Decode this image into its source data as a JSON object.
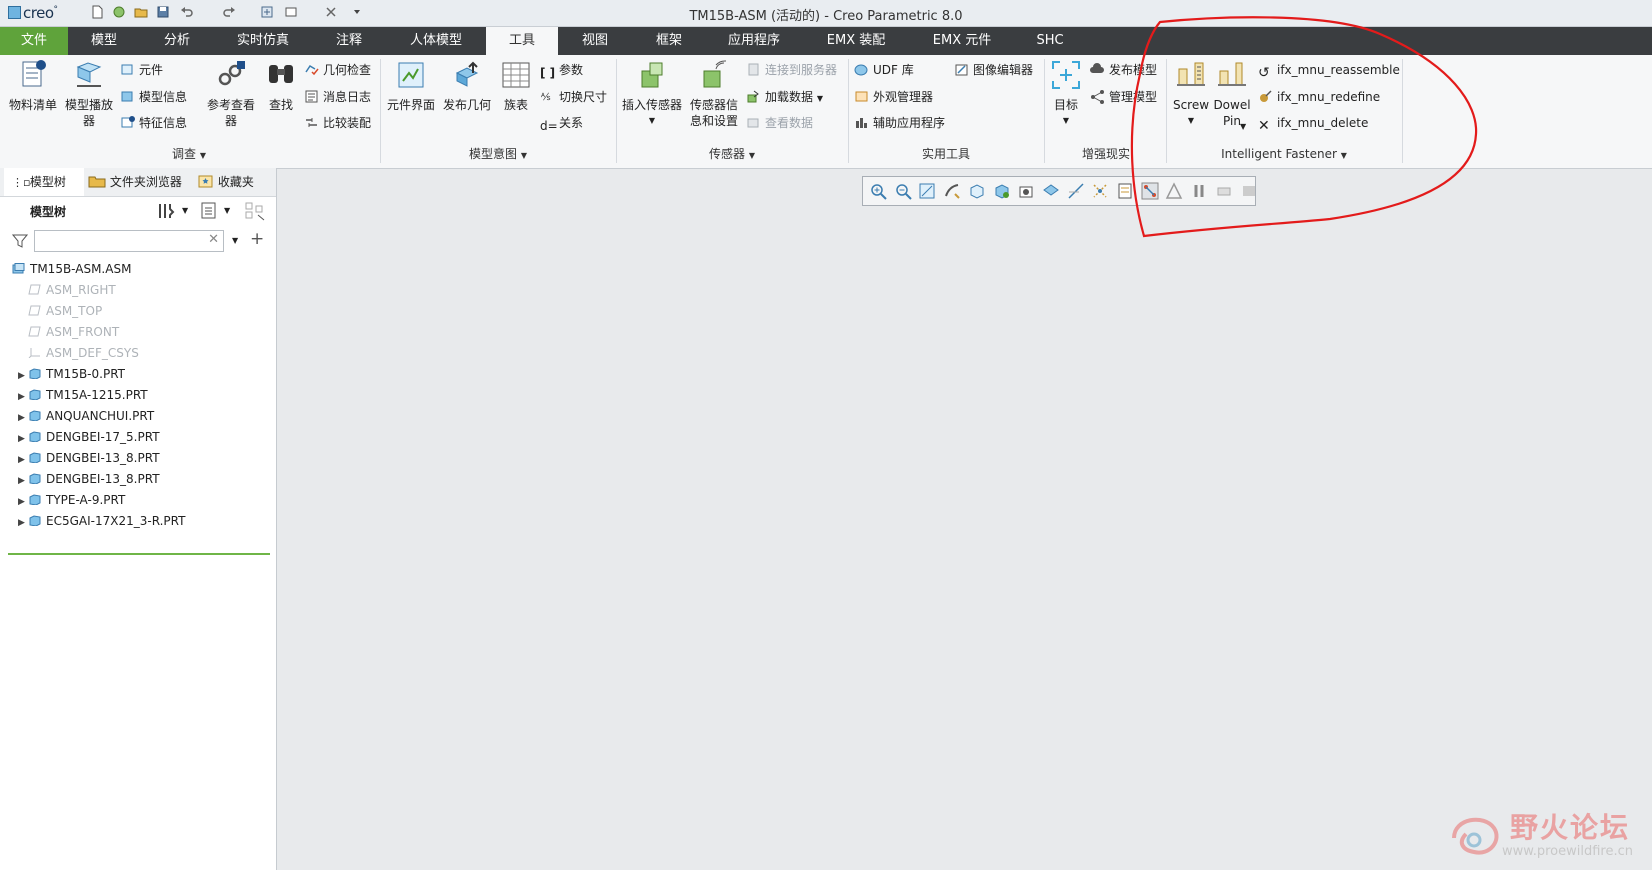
{
  "app": {
    "logo_text": "creo",
    "window_title": "TM15B-ASM (活动的) - Creo Parametric 8.0",
    "quick_access_icons": [
      "new-icon",
      "open-session-icon",
      "open-icon",
      "save-icon",
      "undo-icon",
      "redo-icon",
      "regenerate-icon",
      "window-icon",
      "close-window-icon",
      "customize-icon"
    ]
  },
  "ribbon_tabs": [
    "文件",
    "模型",
    "分析",
    "实时仿真",
    "注释",
    "人体模型",
    "工具",
    "视图",
    "框架",
    "应用程序",
    "EMX 装配",
    "EMX 元件",
    "SHC"
  ],
  "active_tab": "工具",
  "ribbon": {
    "investigate": {
      "label": "调查",
      "bom": "物料清单",
      "model_player": "模型播放器",
      "component": "元件",
      "model_info": "模型信息",
      "feature_info": "特征信息",
      "ref_viewer": "参考查看器",
      "find": "查找",
      "geom_check": "几何检查",
      "message_log": "消息日志",
      "compare_parts": "比较装配"
    },
    "model_intent": {
      "label": "模型意图",
      "comp_interface": "元件界面",
      "publish_geom": "发布几何",
      "family_table": "族表",
      "params": "参数",
      "switch_dims": "切换尺寸",
      "relations": "关系"
    },
    "sensors": {
      "label": "传感器",
      "insert_sensor": "插入传感器",
      "sensor_info": "传感器信息和设置",
      "connect_server": "连接到服务器",
      "load_data": "加载数据",
      "view_data": "查看数据"
    },
    "utilities": {
      "label": "实用工具",
      "udf_lib": "UDF 库",
      "image_editor": "图像编辑器",
      "appearance_mgr": "外观管理器",
      "aux_apps": "辅助应用程序"
    },
    "ar": {
      "label": "增强现实",
      "target": "目标",
      "publish_model": "发布模型",
      "manage_model": "管理模型"
    },
    "fastener": {
      "label": "Intelligent Fastener",
      "screw": "Screw",
      "dowel_pin": "Dowel Pin",
      "reassemble": "ifx_mnu_reassemble",
      "redefine": "ifx_mnu_redefine",
      "delete": "ifx_mnu_delete"
    }
  },
  "left_panel": {
    "tabs": [
      "模型树",
      "文件夹浏览器",
      "收藏夹"
    ],
    "header": "模型树",
    "filter_placeholder": "",
    "tree": [
      {
        "label": "TM15B-ASM.ASM",
        "type": "asm",
        "expandable": false,
        "dim": false,
        "indent": 0
      },
      {
        "label": "ASM_RIGHT",
        "type": "plane",
        "expandable": false,
        "dim": true,
        "indent": 1
      },
      {
        "label": "ASM_TOP",
        "type": "plane",
        "expandable": false,
        "dim": true,
        "indent": 1
      },
      {
        "label": "ASM_FRONT",
        "type": "plane",
        "expandable": false,
        "dim": true,
        "indent": 1
      },
      {
        "label": "ASM_DEF_CSYS",
        "type": "csys",
        "expandable": false,
        "dim": true,
        "indent": 1
      },
      {
        "label": "TM15B-0.PRT",
        "type": "part",
        "expandable": true,
        "dim": false,
        "indent": 1
      },
      {
        "label": "TM15A-1215.PRT",
        "type": "part",
        "expandable": true,
        "dim": false,
        "indent": 1
      },
      {
        "label": "ANQUANCHUI.PRT",
        "type": "part",
        "expandable": true,
        "dim": false,
        "indent": 1
      },
      {
        "label": "DENGBEI-17_5.PRT",
        "type": "part",
        "expandable": true,
        "dim": false,
        "indent": 1
      },
      {
        "label": "DENGBEI-13_8.PRT",
        "type": "part",
        "expandable": true,
        "dim": false,
        "indent": 1
      },
      {
        "label": "DENGBEI-13_8.PRT",
        "type": "part",
        "expandable": true,
        "dim": false,
        "indent": 1
      },
      {
        "label": "TYPE-A-9.PRT",
        "type": "part",
        "expandable": true,
        "dim": false,
        "indent": 1
      },
      {
        "label": "EC5GAI-17X21_3-R.PRT",
        "type": "part",
        "expandable": true,
        "dim": false,
        "indent": 1
      }
    ]
  },
  "view_toolbar": [
    "zoom-in-icon",
    "zoom-out-icon",
    "refit-icon",
    "reorient-icon",
    "saved-views-icon",
    "display-style-icon",
    "perspective-icon",
    "section-icon",
    "datum-display-icon",
    "spin-center-icon",
    "annotation-display-icon",
    "annotation-orient-icon",
    "connection-display-icon",
    "tri-icon",
    "pause-icon",
    "flag-icon"
  ],
  "watermark": {
    "title": "野火论坛",
    "url": "www.proewildfire.cn"
  },
  "colors": {
    "file_tab": "#5fa33b",
    "tab_strip": "#3a3d40",
    "annotation": "#e31b1b",
    "tree_underline": "#6fb547",
    "viewport": "#e8eaec"
  }
}
